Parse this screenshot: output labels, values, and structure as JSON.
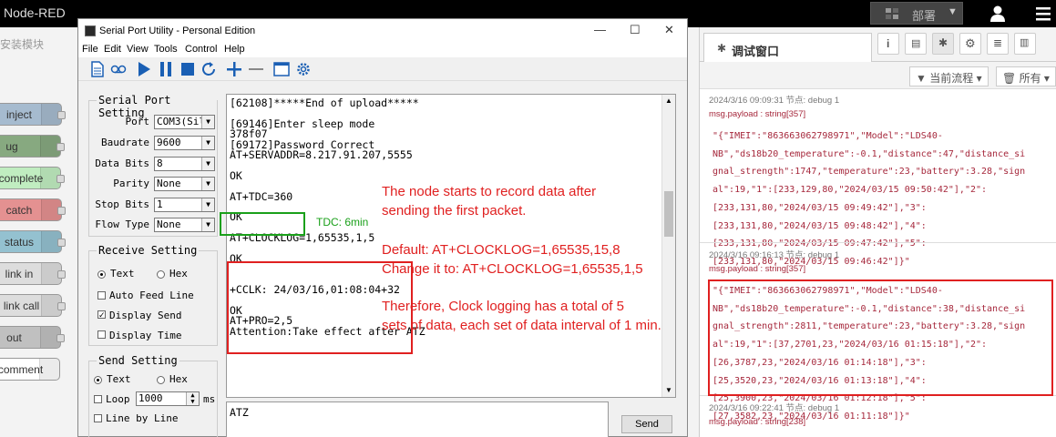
{
  "header": {
    "title": "Node-RED",
    "deploy_label": "部署"
  },
  "palette": {
    "header_label": "安装模块",
    "nodes": [
      {
        "label": "inject",
        "color": "#a6bbcf"
      },
      {
        "label": "ug",
        "color": "#87a980"
      },
      {
        "label": "complete",
        "color": "#c0edc0"
      },
      {
        "label": "catch",
        "color": "#e49191"
      },
      {
        "label": "status",
        "color": "#94c1d0"
      },
      {
        "label": "link in",
        "color": "#dddddd"
      },
      {
        "label": "link call",
        "color": "#dddddd"
      },
      {
        "label": "out",
        "color": "#c0c0c0"
      },
      {
        "label": "comment",
        "color": "#ffffff"
      }
    ]
  },
  "serial": {
    "title": "Serial Port Utility - Personal Edition",
    "menus": [
      "File",
      "Edit",
      "View",
      "Tools",
      "Control",
      "Help"
    ],
    "port_setting": {
      "title": "Serial Port Setting",
      "port_label": "Port",
      "port_value": "COM3(Sil",
      "baud_label": "Baudrate",
      "baud_value": "9600",
      "databits_label": "Data Bits",
      "databits_value": "8",
      "parity_label": "Parity",
      "parity_value": "None",
      "stopbits_label": "Stop Bits",
      "stopbits_value": "1",
      "flow_label": "Flow Type",
      "flow_value": "None"
    },
    "receive_setting": {
      "title": "Receive Setting",
      "text_label": "Text",
      "hex_label": "Hex",
      "auto_feed": "Auto Feed Line",
      "display_send": "Display Send",
      "display_time": "Display Time"
    },
    "send_setting": {
      "title": "Send Setting",
      "text_label": "Text",
      "hex_label": "Hex",
      "loop_label": "Loop",
      "loop_value": "1000",
      "ms_label": "ms",
      "line_by_line": "Line by Line"
    },
    "terminal_lines": [
      "[62108]*****End of upload*****",
      "",
      "[69146]Enter sleep mode",
      "378f07",
      "[69172]Password Correct",
      "AT+SERVADDR=8.217.91.207,5555",
      "",
      "OK",
      "",
      "AT+TDC=360",
      "",
      "OK",
      "",
      "AT+CLOCKLOG=1,65535,1,5",
      "",
      "OK",
      "",
      "",
      "+CCLK: 24/03/16,01:08:04+32",
      "",
      "OK",
      "AT+PRO=2,5",
      "Attention:Take effect after ATZ"
    ],
    "send_input": "ATZ",
    "send_button": "Send"
  },
  "annotations": {
    "a1": "The node starts to record data after",
    "a2": "sending the first packet.",
    "a3": "Default: AT+CLOCKLOG=1,65535,15,8",
    "a4": "Change it to: AT+CLOCKLOG=1,65535,1,5",
    "a5": "Therefore, Clock logging has a total of 5",
    "a6": "sets of data, each set of data interval of 1 min.",
    "tdc": "TDC: 6min"
  },
  "debug": {
    "tab_label": "调试窗口",
    "filter_flow": "当前流程",
    "filter_all": "所有",
    "messages": [
      {
        "meta": "2024/3/16 09:09:31   节点: debug 1",
        "type": "msg.payload : string[357]",
        "lines": [
          "\"{\"IMEI\":\"863663062798971\",\"Model\":\"LDS40-",
          "NB\",\"ds18b20_temperature\":-0.1,\"distance\":47,\"distance_si",
          "gnal_strength\":1747,\"temperature\":23,\"battery\":3.28,\"sign",
          "al\":19,\"1\":[233,129,80,\"2024/03/15 09:50:42\"],\"2\":",
          "[233,131,80,\"2024/03/15 09:49:42\"],\"3\":",
          "[233,131,80,\"2024/03/15 09:48:42\"],\"4\":",
          "[233,131,80,\"2024/03/15 09:47:42\"],\"5\":",
          "[233,131,80,\"2024/03/15 09:46:42\"]}\""
        ]
      },
      {
        "meta": "2024/3/16 09:16:13   节点: debug 1",
        "type": "msg.payload : string[357]",
        "lines": [
          "\"{\"IMEI\":\"863663062798971\",\"Model\":\"LDS40-",
          "NB\",\"ds18b20_temperature\":-0.1,\"distance\":38,\"distance_si",
          "gnal_strength\":2811,\"temperature\":23,\"battery\":3.28,\"sign",
          "al\":19,\"1\":[37,2701,23,\"2024/03/16 01:15:18\"],\"2\":",
          "[26,3787,23,\"2024/03/16 01:14:18\"],\"3\":",
          "[25,3520,23,\"2024/03/16 01:13:18\"],\"4\":",
          "[25,3900,23,\"2024/03/16 01:12:18\"],\"5\":",
          "[27,3582,23,\"2024/03/16 01:11:18\"]}\""
        ]
      },
      {
        "meta": "2024/3/16 09:22:41   节点: debug 1",
        "type": "msg.payload : string[238]",
        "lines": []
      }
    ]
  }
}
